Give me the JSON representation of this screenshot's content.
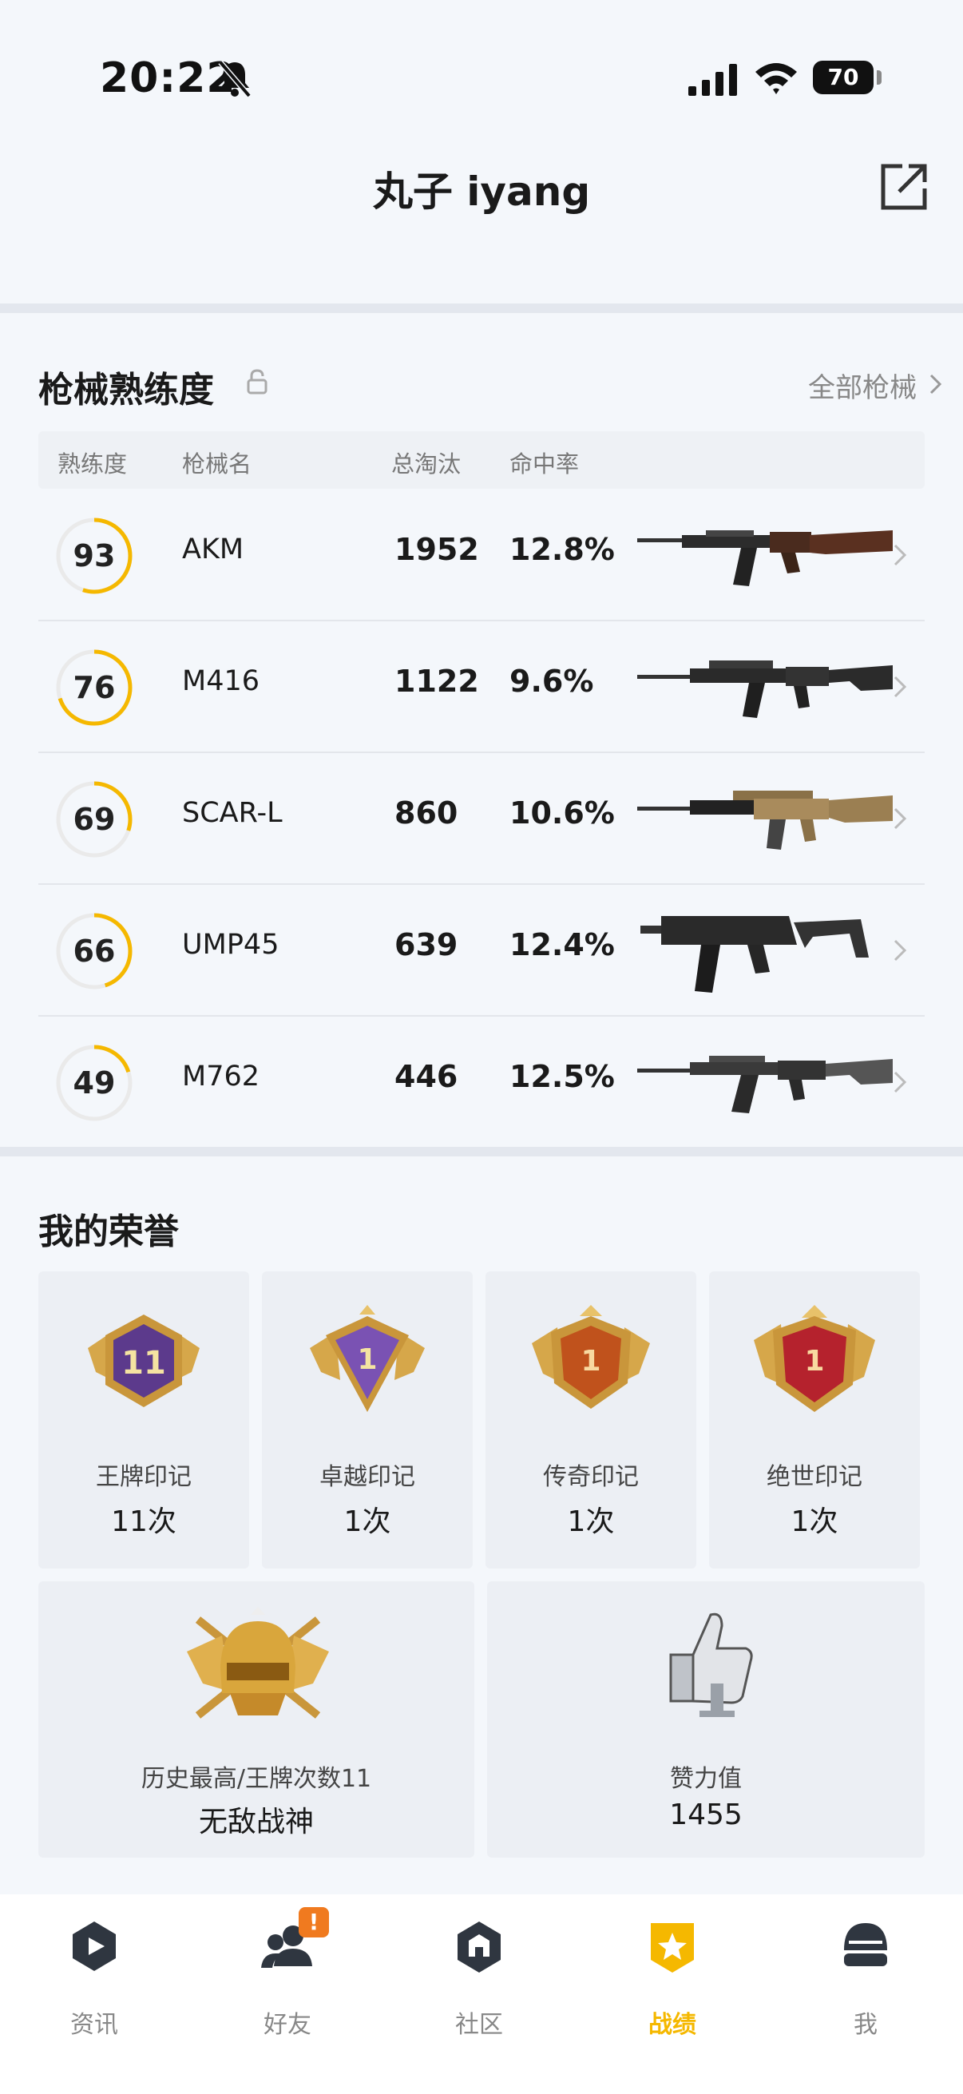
{
  "status": {
    "time": "20:22",
    "battery": "70"
  },
  "header": {
    "title": "丸子 iyang"
  },
  "weapons_section": {
    "title": "枪械熟练度",
    "all_link": "全部枪械",
    "columns": [
      "熟练度",
      "枪械名",
      "总淘汰",
      "命中率"
    ],
    "rows": [
      {
        "proficiency": "93",
        "name": "AKM",
        "kills": "1952",
        "accuracy": "12.8%",
        "ring_fill": 0.55
      },
      {
        "proficiency": "76",
        "name": "M416",
        "kills": "1122",
        "accuracy": "9.6%",
        "ring_fill": 0.7
      },
      {
        "proficiency": "69",
        "name": "SCAR-L",
        "kills": "860",
        "accuracy": "10.6%",
        "ring_fill": 0.3
      },
      {
        "proficiency": "66",
        "name": "UMP45",
        "kills": "639",
        "accuracy": "12.4%",
        "ring_fill": 0.45
      },
      {
        "proficiency": "49",
        "name": "M762",
        "kills": "446",
        "accuracy": "12.5%",
        "ring_fill": 0.2
      }
    ]
  },
  "honors_section": {
    "title": "我的荣誉",
    "cards": [
      {
        "name": "王牌印记",
        "count": "11次",
        "badge_number": "11"
      },
      {
        "name": "卓越印记",
        "count": "1次",
        "badge_number": "1"
      },
      {
        "name": "传奇印记",
        "count": "1次",
        "badge_number": "1"
      },
      {
        "name": "绝世印记",
        "count": "1次",
        "badge_number": "1"
      }
    ],
    "highest": {
      "label": "历史最高/王牌次数11",
      "value": "无敌战神"
    },
    "likes": {
      "label": "赞力值",
      "value": "1455"
    }
  },
  "tabs": [
    {
      "label": "资讯",
      "icon": "news-icon"
    },
    {
      "label": "好友",
      "icon": "friends-icon",
      "badge": "!"
    },
    {
      "label": "社区",
      "icon": "community-icon"
    },
    {
      "label": "战绩",
      "icon": "record-icon",
      "active": true
    },
    {
      "label": "我",
      "icon": "me-icon"
    }
  ],
  "colors": {
    "accent": "#f5b800",
    "badge_orange": "#f07a1f"
  }
}
